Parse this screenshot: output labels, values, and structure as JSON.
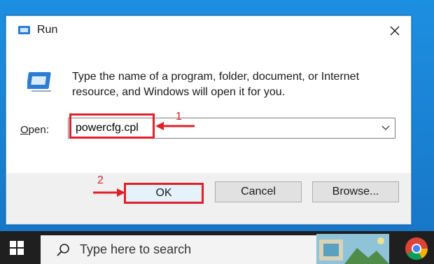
{
  "dialog": {
    "title": "Run",
    "description": "Type the name of a program, folder, document, or Internet resource, and Windows will open it for you.",
    "open_label": "Open:",
    "open_value": "powercfg.cpl",
    "buttons": {
      "ok": "OK",
      "cancel": "Cancel",
      "browse": "Browse..."
    }
  },
  "annotations": {
    "step1": "1",
    "step2": "2",
    "color": "#e0202a"
  },
  "taskbar": {
    "search_placeholder": "Type here to search"
  },
  "icons": [
    "run-icon",
    "close-icon",
    "chevron-down-icon",
    "windows-start-icon",
    "search-icon",
    "chrome-icon"
  ]
}
